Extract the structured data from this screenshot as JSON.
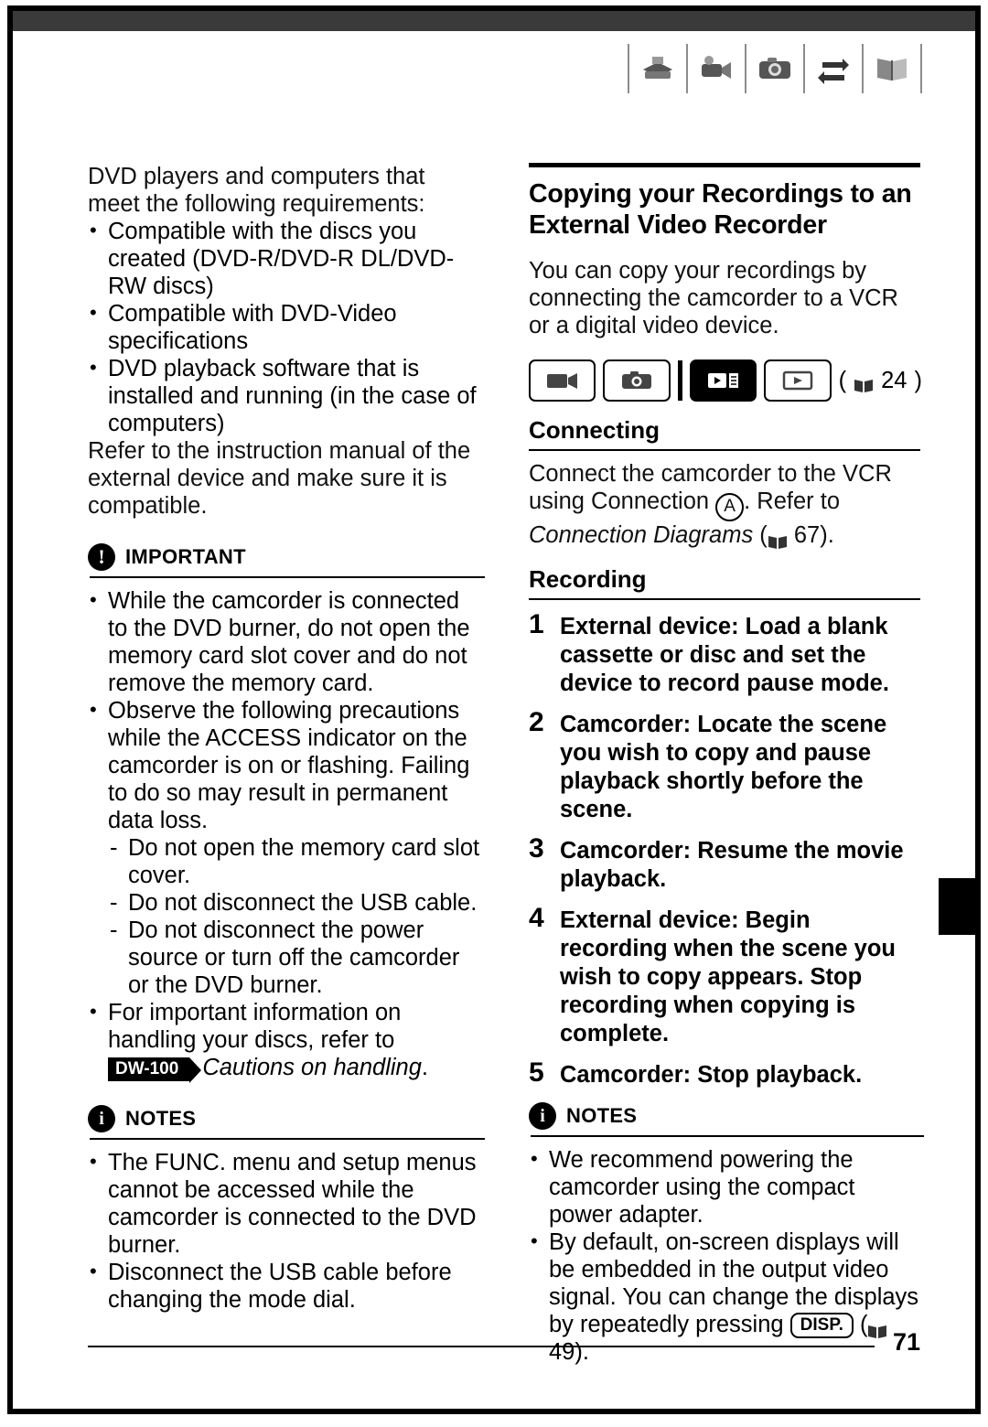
{
  "header": {
    "icons": [
      "dvd-burner-icon",
      "camcorder-icon",
      "camera-icon",
      "transfer-icon",
      "manual-icon"
    ]
  },
  "left_column": {
    "intro": "DVD players and computers that meet the following requirements:",
    "requirements": [
      "Compatible with the discs you created (DVD-R/DVD-R DL/DVD-RW discs)",
      "Compatible with DVD-Video specifications",
      "DVD playback software that is installed and running (in the case of computers)"
    ],
    "refer_note": "Refer to the instruction manual of the external device and make sure it is compatible.",
    "important": {
      "title": "IMPORTANT",
      "items": [
        "While the camcorder is connected to the DVD burner, do not open the memory card slot cover and do not remove the memory card.",
        "Observe the following precautions while the ACCESS indicator on the camcorder is on or flashing. Failing to do so may result in permanent data loss."
      ],
      "sub_items": [
        "Do not open the memory card slot cover.",
        "Do not disconnect the USB cable.",
        "Do not disconnect the power source or turn off the camcorder or the DVD burner."
      ],
      "last_item_prefix": "For important information on handling your discs, refer to ",
      "dw100_badge": "DW-100",
      "last_item_italic": "Cautions on handling",
      "last_item_suffix": "."
    },
    "notes": {
      "title": "NOTES",
      "items": [
        "The FUNC. menu and setup menus cannot be accessed while the camcorder is connected to the DVD burner.",
        "Disconnect the USB cable before changing the mode dial."
      ]
    }
  },
  "right_column": {
    "section_title": "Copying your Recordings to an External Video Recorder",
    "intro": "You can copy your recordings by connecting the camcorder to a VCR or a digital video device.",
    "mode_buttons": [
      {
        "name": "movie-record-mode",
        "active": false
      },
      {
        "name": "photo-record-mode",
        "active": false
      },
      {
        "name": "movie-playback-mode",
        "active": true
      },
      {
        "name": "photo-playback-mode",
        "active": false
      }
    ],
    "mode_page_ref": "( 24)",
    "mode_page_number": "24",
    "connecting": {
      "title": "Connecting",
      "text_before": "Connect the camcorder to the VCR using Connection ",
      "connection_letter": "A",
      "text_after": ". Refer to ",
      "italic_ref": "Connection Diagrams",
      "page_number": "67",
      "closing": ")."
    },
    "recording": {
      "title": "Recording",
      "steps": [
        {
          "num": "1",
          "text": "External device: Load a blank cassette or disc and set the device to record pause mode."
        },
        {
          "num": "2",
          "text": "Camcorder: Locate the scene you wish to copy and pause playback shortly before the scene."
        },
        {
          "num": "3",
          "text": "Camcorder: Resume the movie playback."
        },
        {
          "num": "4",
          "text": "External device: Begin recording when the scene you wish to copy appears. Stop recording when copying is complete."
        },
        {
          "num": "5",
          "text": "Camcorder: Stop playback."
        }
      ]
    },
    "notes": {
      "title": "NOTES",
      "items": [
        "We recommend powering the camcorder using the compact power adapter.",
        "By default, on-screen displays will be embedded in the output video signal. You can change the displays by repeatedly pressing"
      ],
      "disp_badge": "DISP.",
      "disp_page_number": "49",
      "disp_suffix": ")."
    }
  },
  "footer": {
    "page_number": "71"
  }
}
